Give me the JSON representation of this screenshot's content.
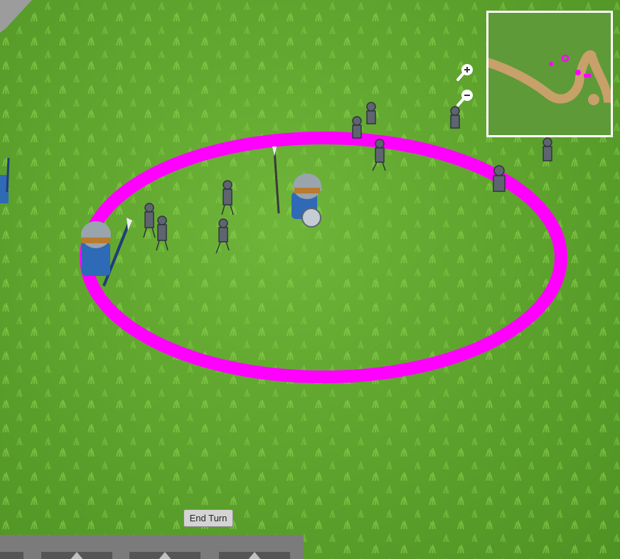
{
  "hud": {
    "end_turn_label": "End Turn"
  },
  "minimap": {
    "zoom_in_icon": "zoom-in-icon",
    "zoom_out_icon": "zoom-out-icon",
    "terrain_color": "#5e9a38",
    "path_color": "#c7a06a",
    "marker_color": "#ff00ff"
  },
  "world": {
    "ground_color": "#5fa52e",
    "selection_ring_color": "#ff00ff"
  },
  "toolbar": {
    "slots": [
      "slot-1",
      "slot-2",
      "slot-3",
      "slot-4"
    ]
  }
}
